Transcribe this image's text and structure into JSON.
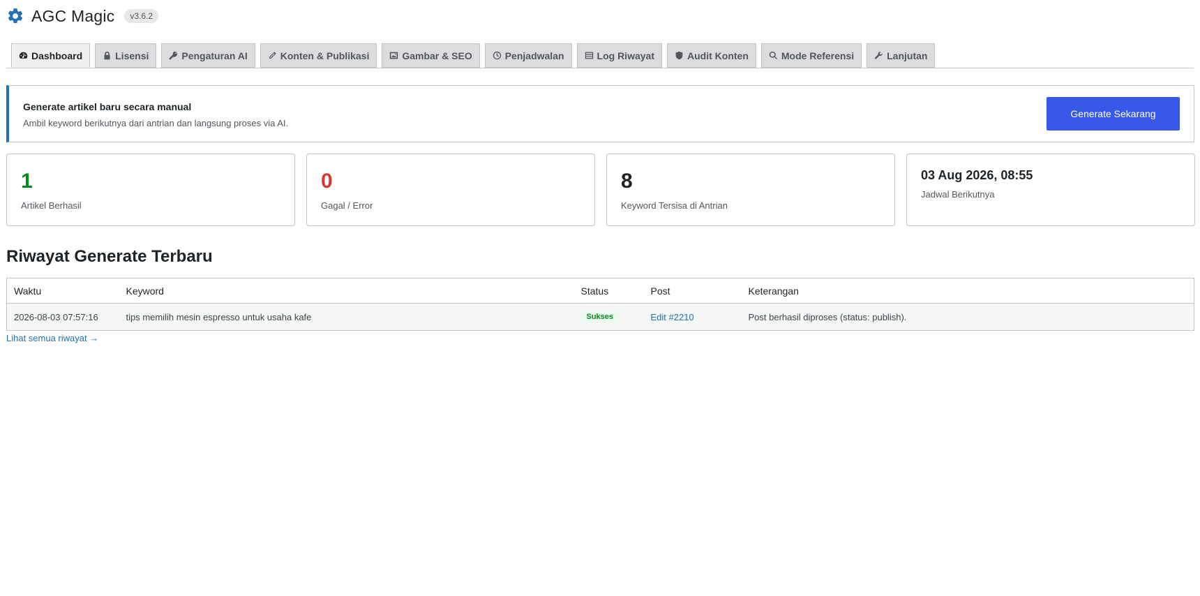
{
  "app": {
    "title": "AGC Magic",
    "version": "v3.6.2",
    "icon": "gear-icon"
  },
  "tabs": [
    {
      "label": "Dashboard",
      "icon": "dashboard-icon",
      "active": true
    },
    {
      "label": "Lisensi",
      "icon": "lock-icon"
    },
    {
      "label": "Pengaturan AI",
      "icon": "key-icon"
    },
    {
      "label": "Konten & Publikasi",
      "icon": "pencil-icon"
    },
    {
      "label": "Gambar & SEO",
      "icon": "image-icon"
    },
    {
      "label": "Penjadwalan",
      "icon": "clock-icon"
    },
    {
      "label": "Log Riwayat",
      "icon": "list-icon"
    },
    {
      "label": "Audit Konten",
      "icon": "shield-icon"
    },
    {
      "label": "Mode Referensi",
      "icon": "search-icon"
    },
    {
      "label": "Lanjutan",
      "icon": "wrench-icon"
    }
  ],
  "manual": {
    "title": "Generate artikel baru secara manual",
    "description": "Ambil keyword berikutnya dari antrian dan langsung proses via AI.",
    "button_label": "Generate Sekarang"
  },
  "stats": [
    {
      "value": "1",
      "label": "Artikel Berhasil",
      "color": "#008a20"
    },
    {
      "value": "0",
      "label": "Gagal / Error",
      "color": "#d63638"
    },
    {
      "value": "8",
      "label": "Keyword Tersisa di Antrian",
      "color": "#1d2327"
    },
    {
      "value": "03 Aug 2026, 08:55",
      "label": "Jadwal Berikutnya",
      "color": "#1d2327"
    }
  ],
  "history": {
    "heading": "Riwayat Generate Terbaru",
    "columns": [
      "Waktu",
      "Keyword",
      "Status",
      "Post",
      "Keterangan"
    ],
    "rows": [
      {
        "time": "2026-08-03 07:57:16",
        "keyword": "tips memilih mesin espresso untuk usaha kafe",
        "status": "Sukses",
        "post": "Edit #2210",
        "note": "Post berhasil diproses (status: publish)."
      }
    ],
    "see_all": "Lihat semua riwayat →"
  },
  "colors": {
    "accent": "#2271b1",
    "button": "#3858e9",
    "success": "#008a20",
    "error": "#d63638"
  }
}
